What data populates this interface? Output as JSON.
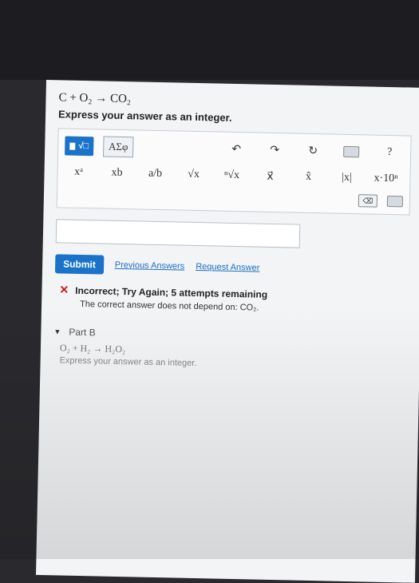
{
  "part_a": {
    "equation": "C + O₂ → CO₂",
    "prompt": "Express your answer as an integer."
  },
  "toolbar": {
    "templates_label": "√□",
    "symbols_label": "ΑΣφ",
    "undo_icon": "↶",
    "redo_icon": "↷",
    "reset_icon": "↻",
    "keyboard_icon": "keyboard-icon",
    "help_label": "?",
    "row2": [
      "xᵃ",
      "xb",
      "a/b",
      "√x",
      "ⁿ√x",
      "x⃗",
      "x̂",
      "|x|",
      "x·10ⁿ"
    ],
    "delete_label": "⌫"
  },
  "answer": {
    "value": ""
  },
  "actions": {
    "submit_label": "Submit",
    "previous_answers": "Previous Answers",
    "request_answer": "Request Answer"
  },
  "feedback": {
    "title": "Incorrect; Try Again; 5 attempts remaining",
    "detail": "The correct answer does not depend on: CO₂."
  },
  "part_b": {
    "label": "Part B",
    "equation": "O₂ + H₂ → H₂O₂",
    "prompt": "Express your answer as an integer."
  },
  "colors": {
    "accent": "#1a73c9",
    "error": "#c81e1e",
    "link": "#1a6fc0"
  }
}
